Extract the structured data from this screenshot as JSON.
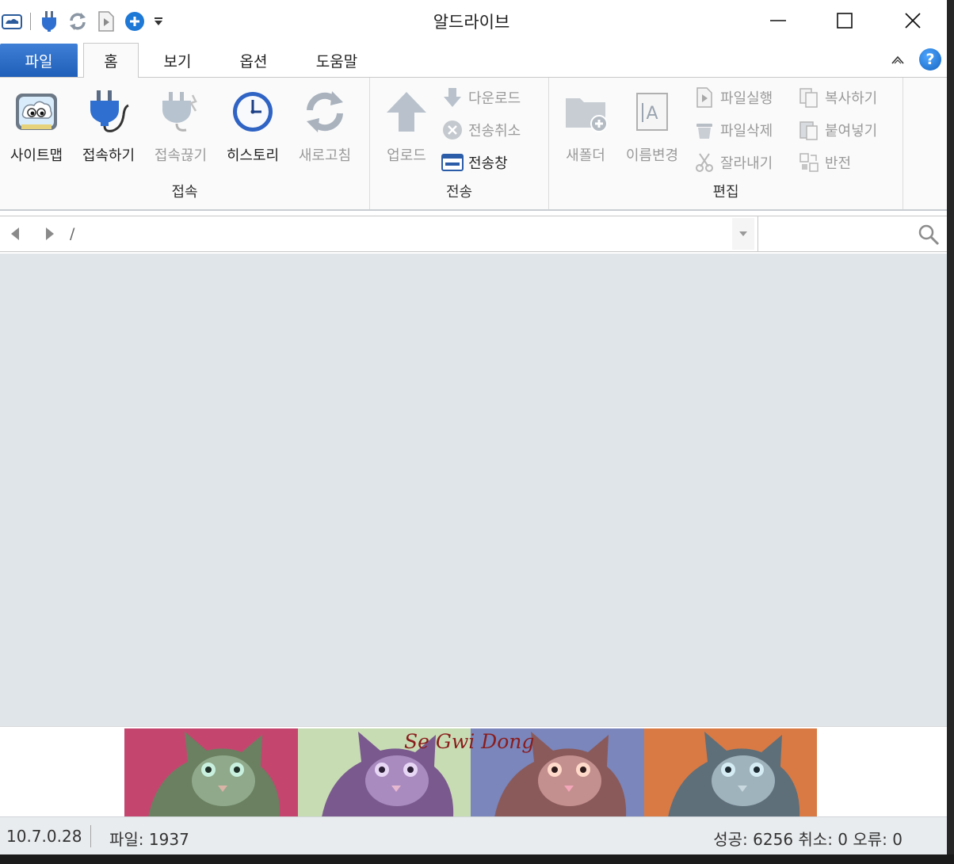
{
  "window": {
    "title": "알드라이브",
    "minimize_icon": "minimize-icon",
    "maximize_icon": "maximize-icon",
    "close_icon": "close-icon"
  },
  "quick_access": [
    "cloud-drive-icon",
    "plug-icon",
    "refresh-icon",
    "file-run-icon",
    "add-icon",
    "customize-dropdown-icon"
  ],
  "tabs": [
    {
      "label": "파일",
      "active": false
    },
    {
      "label": "홈",
      "active": true
    },
    {
      "label": "보기",
      "active": false
    },
    {
      "label": "옵션",
      "active": false
    },
    {
      "label": "도움말",
      "active": false
    }
  ],
  "help_glyph": "?",
  "ribbon": {
    "connect_group": {
      "label": "접속",
      "buttons": [
        {
          "label": "사이트맵",
          "icon": "sitemap-icon",
          "enabled": true
        },
        {
          "label": "접속하기",
          "icon": "connect-plug-icon",
          "enabled": true
        },
        {
          "label": "접속끊기",
          "icon": "disconnect-plug-icon",
          "enabled": false
        },
        {
          "label": "히스토리",
          "icon": "history-clock-icon",
          "enabled": true
        },
        {
          "label": "새로고침",
          "icon": "refresh-icon",
          "enabled": false
        }
      ]
    },
    "transfer_group": {
      "label": "전송",
      "upload": {
        "label": "업로드",
        "icon": "upload-arrow-icon",
        "enabled": false
      },
      "download": {
        "label": "다운로드",
        "icon": "download-arrow-icon",
        "enabled": false
      },
      "cancel": {
        "label": "전송취소",
        "icon": "cancel-transfer-icon",
        "enabled": false
      },
      "window": {
        "label": "전송창",
        "icon": "transfer-window-icon",
        "enabled": true
      }
    },
    "edit_group": {
      "label": "편집",
      "new_folder": {
        "label": "새폴더",
        "icon": "new-folder-icon",
        "enabled": false
      },
      "rename": {
        "label": "이름변경",
        "icon": "rename-icon",
        "enabled": false
      },
      "run_file": {
        "label": "파일실행",
        "icon": "run-file-icon",
        "enabled": false
      },
      "delete_file": {
        "label": "파일삭제",
        "icon": "trash-icon",
        "enabled": false
      },
      "cut": {
        "label": "잘라내기",
        "icon": "scissors-icon",
        "enabled": false
      },
      "copy": {
        "label": "복사하기",
        "icon": "copy-icon",
        "enabled": false
      },
      "paste": {
        "label": "붙여넣기",
        "icon": "paste-icon",
        "enabled": false
      },
      "invert": {
        "label": "반전",
        "icon": "invert-selection-icon",
        "enabled": false
      }
    }
  },
  "address": {
    "path": "/",
    "search_placeholder": ""
  },
  "banner": {
    "text": "Se Gwi Dong",
    "panel_colors": [
      "#c4466f",
      "#c8dcb4",
      "#7a86bc",
      "#d97a44"
    ]
  },
  "status": {
    "ip": "10.7.0.28",
    "files": "파일: 1937",
    "summary": "성공: 6256 취소: 0 오류: 0"
  }
}
